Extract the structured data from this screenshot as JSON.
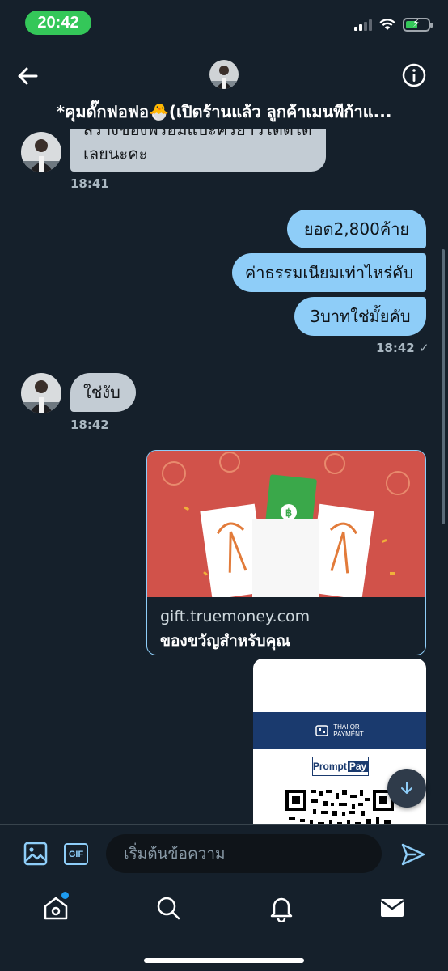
{
  "status_bar": {
    "time": "20:42"
  },
  "header": {
    "title": "*คุมดั๊กฟอฟอ🐣(เปิดร้านแล้ว ลูกค้าเมนพีก้าแ..."
  },
  "messages": [
    {
      "direction": "incoming",
      "text_line1": "สร้างของพร้อมแบะครียาวโดดได",
      "text_line2": "เลยนะคะ",
      "time": "18:41"
    },
    {
      "direction": "outgoing",
      "text": "ยอด2,800ค้าย"
    },
    {
      "direction": "outgoing",
      "text": "ค่าธรรมเนียมเท่าไหร่คับ"
    },
    {
      "direction": "outgoing",
      "text": "3บาทใช่มั้ยคับ",
      "time": "18:42 ✓"
    },
    {
      "direction": "incoming",
      "text": "ใช่งับ",
      "time": "18:42"
    }
  ],
  "link_card": {
    "domain": "gift.truemoney.com",
    "caption": "ของขวัญสำหรับคุณ"
  },
  "qr_card": {
    "band_label_line1": "THAI QR",
    "band_label_line2": "PAYMENT",
    "promptpay_left": "Prompt",
    "promptpay_right": "Pay"
  },
  "composer": {
    "gif_label": "GIF",
    "placeholder": "เริ่มต้นข้อความ"
  },
  "colors": {
    "background": "#15202b",
    "outgoing_bubble": "#8ecdf8",
    "incoming_bubble": "#c3ccd4",
    "accent": "#1d9bf0",
    "time_pill": "#34c759"
  },
  "icons": {
    "back": "arrow-left-icon",
    "info": "info-circle-icon",
    "media": "image-icon",
    "send": "send-icon",
    "scroll": "arrow-down-icon",
    "tabs": [
      "home-icon",
      "search-icon",
      "bell-icon",
      "mail-icon"
    ]
  }
}
